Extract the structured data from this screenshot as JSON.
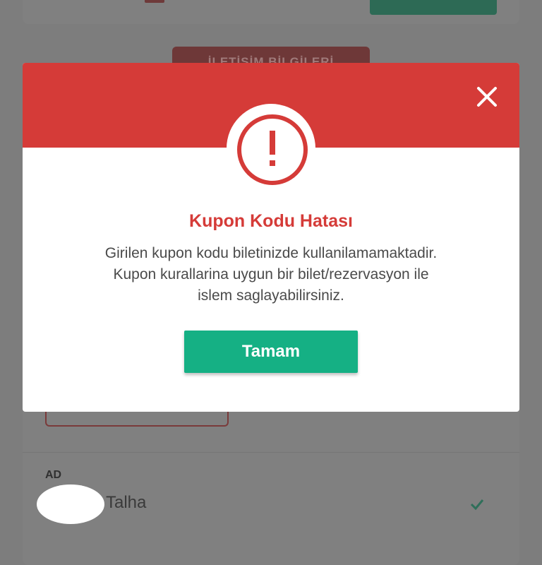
{
  "background": {
    "contact_section_label": "İLETİŞİM BİLGİLERİ",
    "field_label": "AD",
    "field_value": "Talha",
    "field_valid_icon": "checkmark-icon"
  },
  "dialog": {
    "close_icon": "close-icon",
    "status_icon": "exclamation-circle-icon",
    "title": "Kupon Kodu Hatası",
    "message_lines": [
      "Girilen kupon kodu biletinizde kullanilamamaktadir.",
      "Kupon kurallarina uygun bir bilet/rezervasyon ile",
      "islem saglayabilirsiniz."
    ],
    "confirm_label": "Tamam"
  },
  "colors": {
    "accent_red": "#d53b38",
    "confirm_green": "#15b084",
    "overlay": "#7d7d7d"
  }
}
